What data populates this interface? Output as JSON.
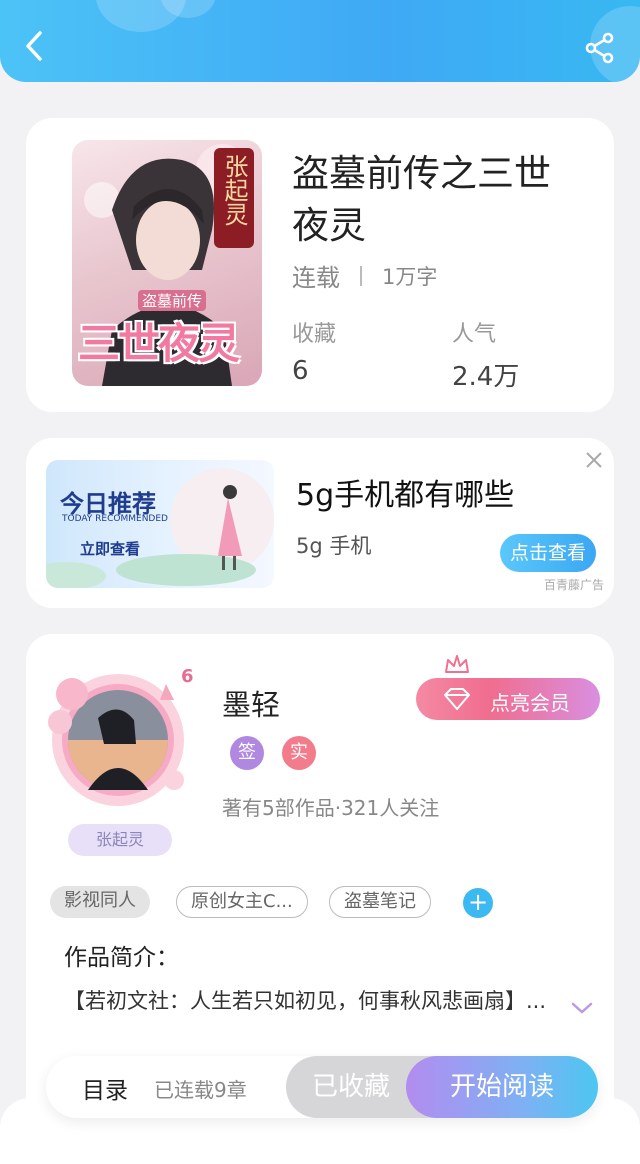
{
  "header": {
    "back_icon": "chevron-left-icon",
    "share_icon": "share-icon"
  },
  "book": {
    "title": "盗墓前传之三世夜灵",
    "cover_text_top": "张起灵",
    "cover_text_small": "盗墓前传",
    "cover_text_big": "三世夜灵",
    "status": "连载",
    "word_count": "1万字",
    "favorites_label": "收藏",
    "favorites_value": "6",
    "popularity_label": "人气",
    "popularity_value": "2.4万"
  },
  "ad": {
    "image_title": "今日推荐",
    "image_subtitle": "TODAY RECOMMENDED",
    "image_button": "立即查看",
    "title": "5g手机都有哪些",
    "subtitle": "5g 手机",
    "button": "点击查看",
    "source": "百青藤广告",
    "close_icon": "close-icon"
  },
  "author": {
    "name": "墨轻",
    "level": "6",
    "frame_name": "张起灵",
    "badge_signed": "签",
    "badge_real": "实",
    "info": "著有5部作品·321人关注",
    "member_button": "点亮会员",
    "tags": [
      "影视同人",
      "原创女主C...",
      "盗墓笔记"
    ],
    "intro_label": "作品简介：",
    "intro_text": "【若初文社：人生若只如初见，何事秋风悲画扇】...",
    "expand_icon": "chevron-down-icon"
  },
  "bottom": {
    "toc_label": "目录",
    "chapters": "已连载9章",
    "fav_button": "已收藏",
    "read_button": "开始阅读"
  },
  "colors": {
    "accent": "#3fa9f5",
    "member": "#f06d8f",
    "read": "#7fb0f3"
  }
}
